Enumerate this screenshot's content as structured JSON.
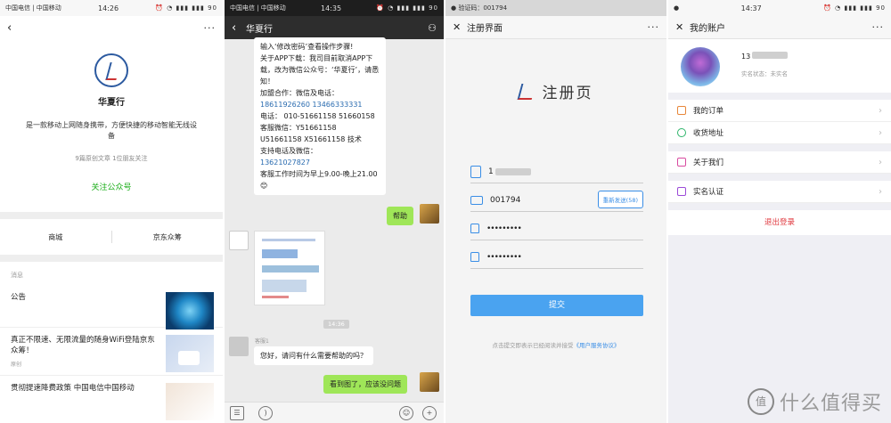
{
  "p1": {
    "status": {
      "carrier": "中国电信 | 中国移动",
      "time": "14:26",
      "icons": "⏰ ◔ ▮▮▮ ▮▮▮ 90"
    },
    "name": "华夏行",
    "desc": "是一款移动上网随身携带，方便快捷的移动智能无线设备",
    "stats": "9篇原创文章   1位朋友关注",
    "follow": "关注公众号",
    "menu": [
      "商城",
      "京东众筹"
    ],
    "section": "消息",
    "articles": [
      {
        "title": "公告",
        "tag": ""
      },
      {
        "title": "真正不限速、无限流量的随身WiFi登陆京东众筹！",
        "tag": "原创"
      },
      {
        "title": "贯彻提速降费政策 中国电信中国移动",
        "tag": ""
      }
    ]
  },
  "p2": {
    "status": {
      "carrier": "中国电信 | 中国移动",
      "time": "14:35",
      "icons": "⏰ ◔ ▮▮▮ ▮▮▮ 90"
    },
    "title": "华夏行",
    "bubble1": [
      {
        "t": "输入‘修改密码’查看操作步骤!",
        "c": ""
      },
      {
        "t": "关于APP下载：我司目前取消APP下载，改为微信公众号：‘华夏行’，请悉知！",
        "c": ""
      },
      {
        "t": "加盟合作：微信及电话：",
        "c": ""
      },
      {
        "t": "18611926260  13466333331",
        "c": "link"
      },
      {
        "t": "电话：  010-51661158 51660158",
        "c": "mix"
      },
      {
        "t": "客服微信：Y51661158",
        "c": "mix2"
      },
      {
        "t": "U51661158    X51661158    技术",
        "c": "mix3"
      },
      {
        "t": "支持电话及微信：",
        "c": ""
      },
      {
        "t": "13621027827",
        "c": "link"
      },
      {
        "t": "客服工作时间为早上9.00-晚上21.00😊",
        "c": ""
      }
    ],
    "help": "帮助",
    "time_chip": "14:36",
    "kefu_name": "客服1",
    "kefu_msg": "您好，请问有什么需要帮助的吗？",
    "reply": "看到图了，应该没问题"
  },
  "p3": {
    "status": {
      "left": "● 验证码：001794",
      "time": "",
      "icons": ""
    },
    "title": "注册界面",
    "brand": "注册页",
    "phone": "1",
    "code": "001794",
    "resend": "重新发送(58)",
    "pwd1": "•••••••••",
    "pwd2": "•••••••••",
    "submit": "提交",
    "agree_pre": "点击提交即表示已经阅读并接受",
    "agree_link": "《用户服务协议》"
  },
  "p4": {
    "status": {
      "carrier": "●",
      "time": "14:37",
      "icons": "⏰ ◔ ▮▮▮ ▮▮▮ 90"
    },
    "title": "我的账户",
    "uname": "13",
    "real": "实名状态：未实名",
    "items": [
      {
        "label": "我的订单",
        "color": "#e8873a"
      },
      {
        "label": "收货地址",
        "color": "#2fb56b"
      },
      {
        "label": "关于我们",
        "color": "#d84aa0"
      },
      {
        "label": "实名认证",
        "color": "#9b4ad8"
      }
    ],
    "logout": "退出登录",
    "wm_badge": "值",
    "wm_text": "什么值得买"
  }
}
